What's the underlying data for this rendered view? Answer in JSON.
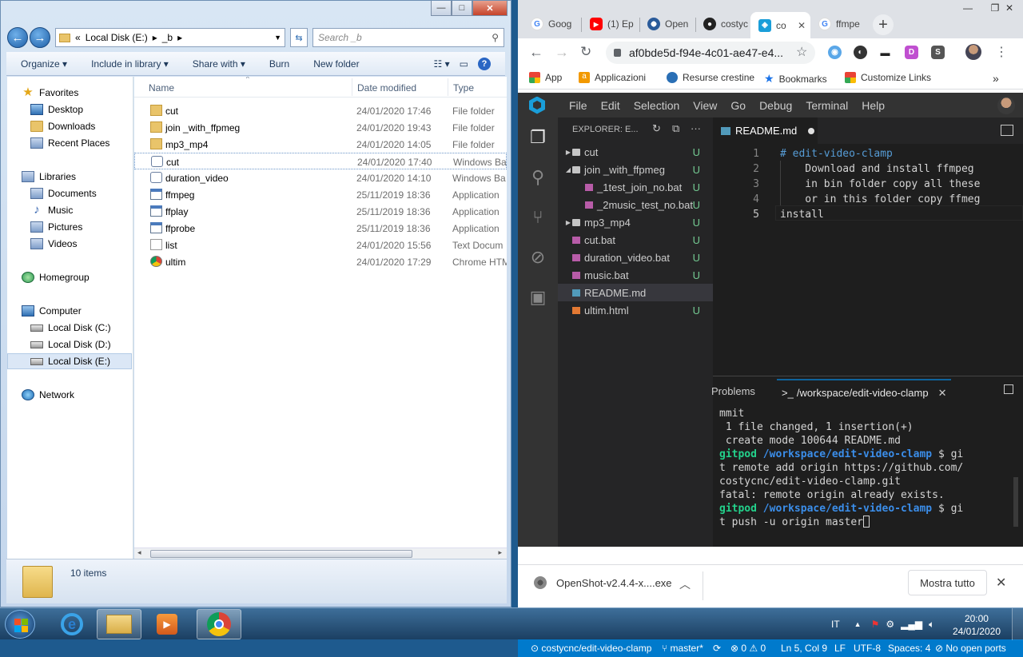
{
  "explorer": {
    "address": {
      "chevrons": "«",
      "crumbs": [
        "Local Disk (E:)",
        "_b"
      ]
    },
    "search_placeholder": "Search _b",
    "toolbar": {
      "organize": "Organize",
      "include": "Include in library",
      "share": "Share with",
      "burn": "Burn",
      "new_folder": "New folder"
    },
    "nav": {
      "favorites": "Favorites",
      "desktop": "Desktop",
      "downloads": "Downloads",
      "recent": "Recent Places",
      "libraries": "Libraries",
      "documents": "Documents",
      "music": "Music",
      "pictures": "Pictures",
      "videos": "Videos",
      "homegroup": "Homegroup",
      "computer": "Computer",
      "disk_c": "Local Disk (C:)",
      "disk_d": "Local Disk (D:)",
      "disk_e": "Local Disk (E:)",
      "network": "Network"
    },
    "columns": {
      "name": "Name",
      "date": "Date modified",
      "type": "Type"
    },
    "files": [
      {
        "name": "cut",
        "date": "24/01/2020 17:46",
        "type": "File folder",
        "icon": "folder"
      },
      {
        "name": "join _with_ffpmeg",
        "date": "24/01/2020 19:43",
        "type": "File folder",
        "icon": "folder"
      },
      {
        "name": "mp3_mp4",
        "date": "24/01/2020 14:05",
        "type": "File folder",
        "icon": "folder"
      },
      {
        "name": "cut",
        "date": "24/01/2020 17:40",
        "type": "Windows Ba",
        "icon": "batch"
      },
      {
        "name": "duration_video",
        "date": "24/01/2020 14:10",
        "type": "Windows Ba",
        "icon": "batch"
      },
      {
        "name": "ffmpeg",
        "date": "25/11/2019 18:36",
        "type": "Application",
        "icon": "application"
      },
      {
        "name": "ffplay",
        "date": "25/11/2019 18:36",
        "type": "Application",
        "icon": "application"
      },
      {
        "name": "ffprobe",
        "date": "25/11/2019 18:36",
        "type": "Application",
        "icon": "application"
      },
      {
        "name": "list",
        "date": "24/01/2020 15:56",
        "type": "Text Docum",
        "icon": "text"
      },
      {
        "name": "ultim",
        "date": "24/01/2020 17:29",
        "type": "Chrome HTM",
        "icon": "chrome"
      }
    ],
    "item_count": "10 items"
  },
  "browser": {
    "tabs": [
      {
        "label": "Goog",
        "icon": "google"
      },
      {
        "label": "(1) Ep",
        "icon": "youtube"
      },
      {
        "label": "Open",
        "icon": "openshot"
      },
      {
        "label": "costyc",
        "icon": "github"
      },
      {
        "label": "co",
        "icon": "gitpod"
      },
      {
        "label": "ffmpe",
        "icon": "google"
      }
    ],
    "url": "af0bde5d-f94e-4c01-ae47-e4...",
    "bookmarks": {
      "apps": "App",
      "applicazioni": "Applicazioni",
      "resurse": "Resurse crestine",
      "bookmarks": "Bookmarks",
      "customize": "Customize Links",
      "more": "»"
    }
  },
  "ide": {
    "menu": [
      "File",
      "Edit",
      "Selection",
      "View",
      "Go",
      "Debug",
      "Terminal",
      "Help"
    ],
    "explorer_title": "EXPLORER: E...",
    "tree": [
      {
        "label": "cut",
        "kind": "folder",
        "collapsed": true,
        "status": "U"
      },
      {
        "label": "join _with_ffpmeg",
        "kind": "folder",
        "collapsed": false,
        "status": "U"
      },
      {
        "label": "_1test_join_no.bat",
        "kind": "bat",
        "status": "U"
      },
      {
        "label": "_2music_test_no.bat",
        "kind": "bat",
        "status": "U"
      },
      {
        "label": "mp3_mp4",
        "kind": "folder",
        "collapsed": true,
        "status": "U"
      },
      {
        "label": "cut.bat",
        "kind": "bat",
        "status": "U"
      },
      {
        "label": "duration_video.bat",
        "kind": "bat",
        "status": "U"
      },
      {
        "label": "music.bat",
        "kind": "bat",
        "status": "U"
      },
      {
        "label": "README.md",
        "kind": "md",
        "status": ""
      },
      {
        "label": "ultim.html",
        "kind": "html",
        "status": "U"
      }
    ],
    "editor_tab": "README.md",
    "lines": [
      {
        "n": "1",
        "text": "# edit-video-clamp"
      },
      {
        "n": "2",
        "text": "    Download and install ffmpeg"
      },
      {
        "n": "3",
        "text": "    in bin folder copy all these"
      },
      {
        "n": "4",
        "text": "    or in this folder copy ffmeg"
      },
      {
        "n": "5",
        "text": "install"
      }
    ],
    "panel": {
      "problems": "Problems",
      "terminal_prefix": ">_",
      "terminal": "/workspace/edit-video-clamp"
    },
    "terminal": [
      {
        "t": "mmit"
      },
      {
        "t": " 1 file changed, 1 insertion(+)"
      },
      {
        "t": " create mode 100644 README.md"
      },
      {
        "prompt_user": "gitpod",
        "prompt_path": "/workspace/edit-video-clamp",
        "t": " $ gi"
      },
      {
        "t": "t remote add origin https://github.com/"
      },
      {
        "t": "costycnc/edit-video-clamp.git"
      },
      {
        "t": "fatal: remote origin already exists."
      },
      {
        "prompt_user": "gitpod",
        "prompt_path": "/workspace/edit-video-clamp",
        "t": " $ gi"
      },
      {
        "t": "t push -u origin master"
      }
    ],
    "status": {
      "repo": "costycnc/edit-video-clamp",
      "branch": "master*",
      "errors": "0",
      "warnings": "0",
      "position": "Ln 5, Col 9",
      "eol": "LF",
      "encoding": "UTF-8",
      "spaces": "Spaces: 4",
      "ports": "No open ports"
    }
  },
  "downloads": {
    "file": "OpenShot-v2.4.4-x....exe",
    "show_all": "Mostra tutto"
  },
  "taskbar": {
    "lang": "IT",
    "time": "20:00",
    "date": "24/01/2020"
  }
}
